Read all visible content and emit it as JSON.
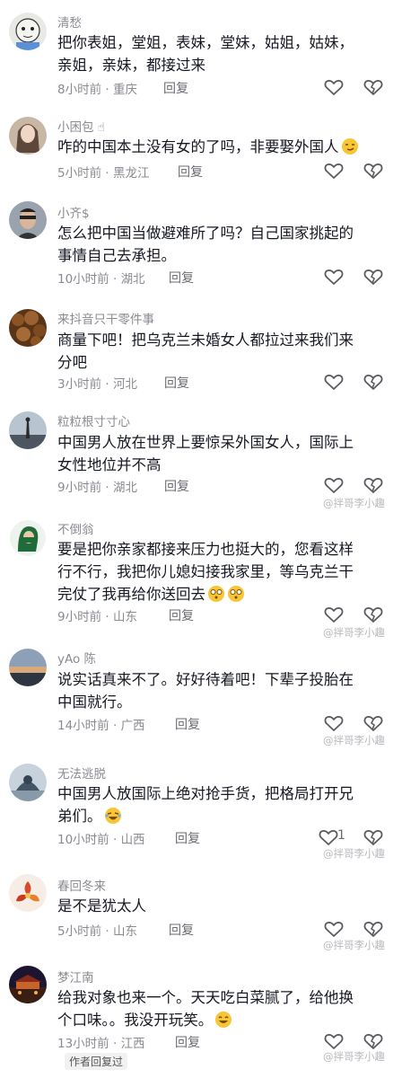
{
  "comments": [
    {
      "username": "清愁",
      "text": "把你表姐，堂姐，表妹，堂妹，姑姐，姑妹，亲姐，亲妹，都接过来",
      "time": "8小时前",
      "location": "重庆",
      "reply": "回复"
    },
    {
      "username": "小困包",
      "text": "咋的中国本土没有女的了吗，非要娶外国人",
      "time": "5小时前",
      "location": "黑龙江",
      "reply": "回复"
    },
    {
      "username": "小齐$",
      "text": "怎么把中国当做避难所了吗？自己国家挑起的事情自己去承担。",
      "time": "10小时前",
      "location": "湖北",
      "reply": "回复"
    },
    {
      "username": "来抖音只干零件事",
      "text": "商量下吧！把乌克兰未婚女人都拉过来我们来分吧",
      "time": "3小时前",
      "location": "河北",
      "reply": "回复"
    },
    {
      "username": "粒粒根寸寸心",
      "text": "中国男人放在世界上要惊呆外国女人，国际上女性地位并不高",
      "time": "9小时前",
      "location": "湖北",
      "reply": "回复"
    },
    {
      "username": "不倒翁",
      "text": "要是把你亲家都接来压力也挺大的，您看这样行不行，我把你儿媳妇接我家里，等乌克兰干完仗了我再给你送回去",
      "time": "9小时前",
      "location": "山东",
      "reply": "回复"
    },
    {
      "username": "yAo 陈",
      "text": "说实话真来不了。好好待着吧！下辈子投胎在中国就行。",
      "time": "14小时前",
      "location": "广西",
      "reply": "回复"
    },
    {
      "username": "无法逃脱",
      "text": "中国男人放国际上绝对抢手货，把格局打开兄弟们。",
      "time": "10小时前",
      "location": "山西",
      "reply": "回复",
      "likes": "1"
    },
    {
      "username": "春回冬来",
      "text": "是不是犹太人",
      "time": "5小时前",
      "location": "山东",
      "reply": "回复"
    },
    {
      "username": "梦江南",
      "text": "给我对象也来一个。天天吃白菜腻了，给他换个口味。。我没开玩笑。",
      "time": "13小时前",
      "location": "江西",
      "reply": "回复"
    }
  ],
  "author_replied": "作者回复过",
  "watermark": "@拌哥李小趣",
  "colors": {
    "text": "#161823",
    "meta": "#8a8b91",
    "icon": "#5a5b60"
  }
}
